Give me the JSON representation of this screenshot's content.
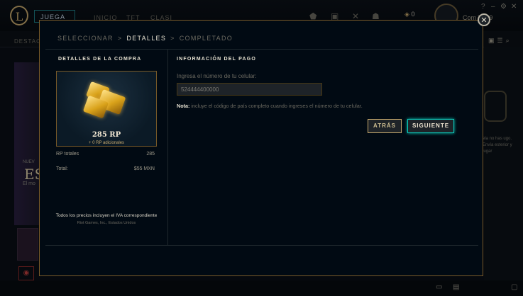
{
  "client": {
    "logo_letter": "L",
    "play_label": "JUEGA",
    "nav": [
      "INICIO",
      "TFT",
      "CLASI"
    ],
    "rp_balance": "0",
    "summoner_name": "Com TT29",
    "subnav_label": "DESTACA",
    "left_banner_big": "ES",
    "left_banner_small": "NUEV",
    "left_banner_sub": "El mo",
    "right_text": "ela no has ugo. Envía esterior y jugar"
  },
  "modal": {
    "breadcrumb": {
      "step1": "SELECCIONAR",
      "step2": "DETALLES",
      "step3": "COMPLETADO",
      "sep": ">"
    },
    "close_label": "✕",
    "purchase": {
      "title": "DETALLES DE LA COMPRA",
      "rp_amount": "285 RP",
      "rp_bonus": "+ 0 RP adicionales",
      "total_rp_label": "RP totales",
      "total_rp_value": "285",
      "total_label": "Total:",
      "total_value": "$55 MXN",
      "tax_note": "Todos los precios incluyen el IVA correspondiente",
      "company": "Riot Games, Inc., Estados Unidos"
    },
    "payment": {
      "title": "INFORMACIÓN DEL PAGO",
      "phone_label": "Ingresa el número de tu celular:",
      "phone_value": "524444400000",
      "note_bold": "Nota:",
      "note_text": " incluye el código de país completo cuando ingreses el número de tu celular.",
      "back_label": "ATRÁS",
      "next_label": "SIGUIENTE"
    }
  },
  "colors": {
    "gold": "#c8aa6e",
    "teal": "#0ac8b9",
    "modal_bg": "#010a13"
  }
}
